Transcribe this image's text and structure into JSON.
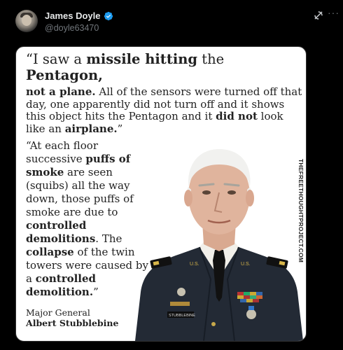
{
  "author": {
    "display_name": "James Doyle",
    "handle": "@doyle63470",
    "verified": true
  },
  "header_icons": [
    "avatar-icon",
    "verified-badge-icon",
    "grok-icon",
    "more-options-icon"
  ],
  "more_label": "···",
  "media": {
    "quote_line1_a": "“I saw a ",
    "quote_line1_b": "missile hitting",
    "quote_line1_c": " the ",
    "quote_line1_d": "Pentagon,",
    "quote_line2_bold": "not a plane.",
    "quote_line2_rest": " All of the sensors were turned off that day, one apparently did not turn off and it shows this object hits the Pentagon and it ",
    "quote_line2_bold2": "did not",
    "quote_line2_rest2": " look like an ",
    "quote_line2_bold3": "airplane.",
    "quote_line2_end": "”",
    "quote2": [
      {
        "t": "“At each floor successive ",
        "b": false
      },
      {
        "t": "puffs of smoke",
        "b": true
      },
      {
        "t": " are seen (squibs) all the way down, those puffs of smoke are due to ",
        "b": false
      },
      {
        "t": "controlled demolitions",
        "b": true
      },
      {
        "t": ". The ",
        "b": false
      },
      {
        "t": "collapse",
        "b": true
      },
      {
        "t": " of the twin towers were caused by a ",
        "b": false
      },
      {
        "t": "controlled demolition.",
        "b": true
      },
      {
        "t": "”",
        "b": false
      }
    ],
    "attribution_title": "Major General",
    "attribution_name": "Albert Stubblebine",
    "side_credit": "THEFREETHOUGHTPROJECT.COM",
    "uniform_text_collar_left": "U.S.",
    "uniform_text_collar_right": "U.S.",
    "nametag": "STUBBLEBINE"
  },
  "colors": {
    "background": "#000000",
    "text_primary": "#e7e9ea",
    "text_secondary": "#71767b",
    "verified": "#1d9bf0",
    "media_bg": "#ffffff"
  }
}
